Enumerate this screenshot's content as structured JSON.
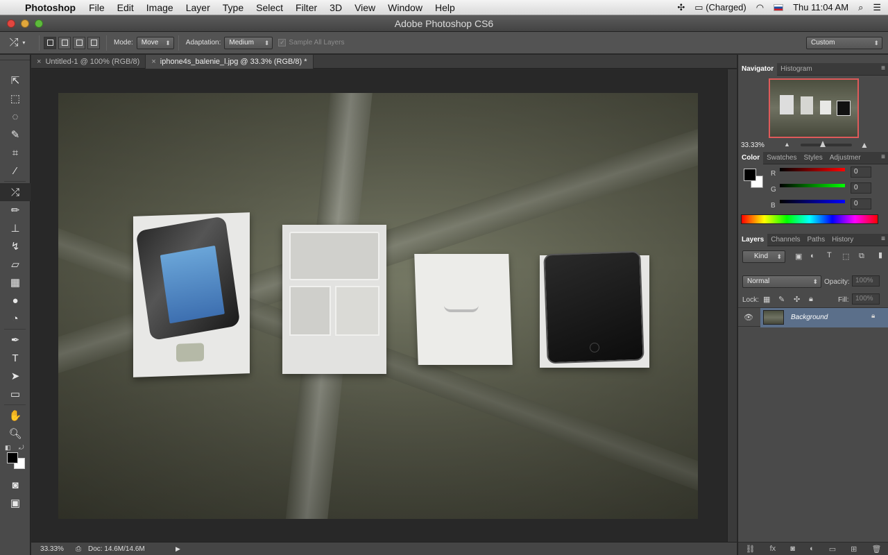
{
  "menubar": {
    "app_name": "Photoshop",
    "items": [
      "File",
      "Edit",
      "Image",
      "Layer",
      "Type",
      "Select",
      "Filter",
      "3D",
      "View",
      "Window",
      "Help"
    ],
    "battery": "(Charged)",
    "clock": "Thu 11:04 AM"
  },
  "window": {
    "title": "Adobe Photoshop CS6"
  },
  "options": {
    "mode_label": "Mode:",
    "mode_value": "Move",
    "adaptation_label": "Adaptation:",
    "adaptation_value": "Medium",
    "sample_all_layers": "Sample All Layers",
    "workspace": "Custom"
  },
  "tabs": [
    {
      "label": "Untitled-1 @ 100% (RGB/8)"
    },
    {
      "label": "iphone4s_balenie_l.jpg @ 33.3% (RGB/8) *"
    }
  ],
  "status": {
    "zoom": "33.33%",
    "doc": "Doc: 14.6M/14.6M"
  },
  "navigator": {
    "tabs": [
      "Navigator",
      "Histogram"
    ],
    "zoom": "33.33%"
  },
  "color_panel": {
    "tabs": [
      "Color",
      "Swatches",
      "Styles",
      "Adjustmer"
    ],
    "r_label": "R",
    "g_label": "G",
    "b_label": "B",
    "r_value": "0",
    "g_value": "0",
    "b_value": "0"
  },
  "layers_panel": {
    "tabs": [
      "Layers",
      "Channels",
      "Paths",
      "History"
    ],
    "kind": "Kind",
    "blend_mode": "Normal",
    "opacity_label": "Opacity:",
    "opacity_value": "100%",
    "lock_label": "Lock:",
    "fill_label": "Fill:",
    "fill_value": "100%",
    "layer_name": "Background"
  },
  "colors": {
    "accent": "#e05a5a",
    "panel_bg": "#4a4a4a",
    "layer_selected": "#5b6f8a"
  }
}
